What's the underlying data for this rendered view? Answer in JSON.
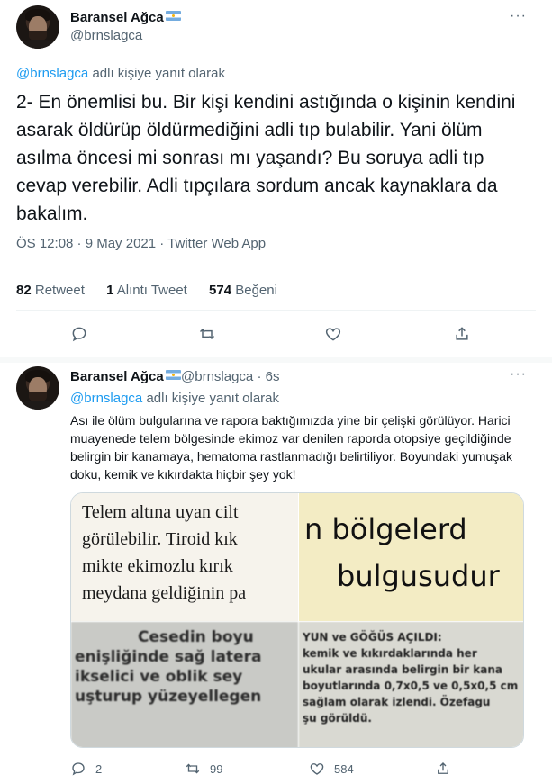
{
  "main_tweet": {
    "author": {
      "name": "Baransel Ağca",
      "handle": "@brnslagca",
      "flag": "argentina-flag-icon"
    },
    "reply_to": {
      "handle": "@brnslagca",
      "text": " adlı kişiye yanıt olarak"
    },
    "body": "2- En önemlisi bu. Bir kişi kendini astığında o kişinin kendini asarak öldürüp öldürmediğini adli tıp bulabilir. Yani ölüm asılma öncesi mi sonrası mı yaşandı? Bu soruya adli tıp cevap verebilir. Adli tıpçılara sordum ancak kaynaklara da bakalım.",
    "meta": "ÖS 12:08 · 9 May 2021 · Twitter Web App",
    "stats": {
      "retweets_count": "82",
      "retweets_label": "Retweet",
      "quotes_count": "1",
      "quotes_label": "Alıntı Tweet",
      "likes_count": "574",
      "likes_label": "Beğeni"
    },
    "actions": [
      "reply-icon",
      "retweet-icon",
      "like-icon",
      "share-icon"
    ]
  },
  "reply_tweet": {
    "author": {
      "name": "Baransel Ağca",
      "handle": "@brnslagca",
      "time": "· 6s"
    },
    "reply_to": {
      "handle": "@brnslagca",
      "text": " adlı kişiye yanıt olarak"
    },
    "body": "Ası ile ölüm bulgularına ve rapora baktığımızda yine bir çelişki görülüyor. Harici muayenede telem bölgesinde ekimoz var denilen raporda otopsiye geçildiğinde belirgin bir kanamaya, hematoma rastlanmadığı belirtiliyor. Boyundaki yumuşak doku, kemik ve kıkırdakta hiçbir şey yok!",
    "media": {
      "tile1": [
        "Telem altına uyan cilt",
        "görülebilir. Tiroid kık",
        "mikte ekimozlu kırık",
        "meydana geldiğinin pa"
      ],
      "tile2": [
        "n  bölgelerd",
        "bulgusudur"
      ],
      "tile3": [
        "Cesedin boyu",
        "enişliğinde sağ latera",
        "ikselici ve oblik sey",
        "uşturup yüzeyellegen"
      ],
      "tile4": [
        "YUN ve GÖĞÜS AÇILDI:",
        "kemik ve kıkırdaklarında her",
        "ukular arasında belirgin bir kana",
        "boyutlarında 0,7x0,5  ve 0,5x0,5 cm",
        "sağlam olarak izlendi. Özefagu",
        "şu görüldü."
      ]
    },
    "actions": {
      "reply_count": "2",
      "retweet_count": "99",
      "like_count": "584"
    }
  },
  "colors": {
    "link": "#1d9bf0",
    "secondary": "#536471",
    "text": "#0f1419",
    "border": "#eff3f4"
  }
}
